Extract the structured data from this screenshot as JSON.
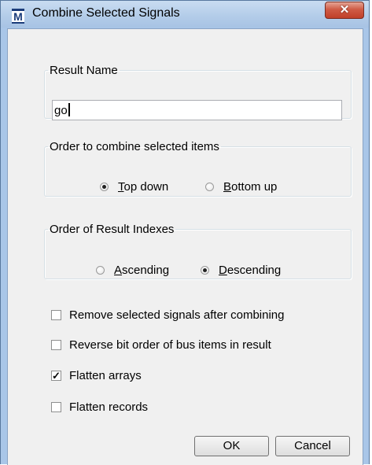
{
  "window": {
    "title": "Combine Selected Signals",
    "icon_letter": "M",
    "close_glyph": "✕"
  },
  "result_name": {
    "legend": "Result Name",
    "value": "go"
  },
  "order_combine": {
    "legend": "Order to combine selected items",
    "options": [
      {
        "label_underlined": "T",
        "label_rest": "op down",
        "selected": true
      },
      {
        "label_underlined": "B",
        "label_rest": "ottom up",
        "selected": false
      }
    ]
  },
  "order_indexes": {
    "legend": "Order of Result Indexes",
    "options": [
      {
        "label_underlined": "A",
        "label_rest": "scending",
        "selected": false
      },
      {
        "label_underlined": "D",
        "label_rest": "escending",
        "selected": true
      }
    ]
  },
  "checkboxes": [
    {
      "label": "Remove selected signals after combining",
      "checked": false
    },
    {
      "label": "Reverse bit order of bus items in result",
      "checked": false
    },
    {
      "label": "Flatten arrays",
      "checked": true
    },
    {
      "label": "Flatten records",
      "checked": false
    }
  ],
  "buttons": {
    "ok": "OK",
    "cancel": "Cancel"
  }
}
